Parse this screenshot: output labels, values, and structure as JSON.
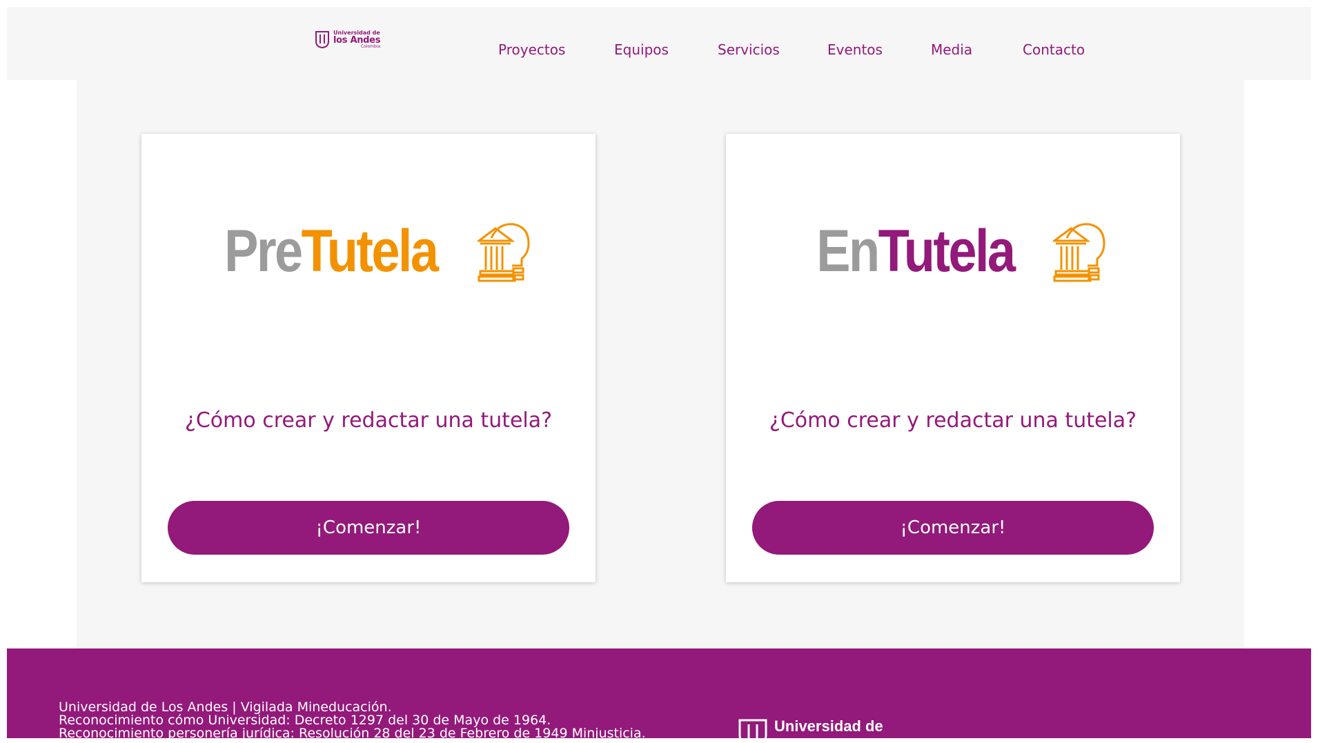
{
  "header": {
    "logo": {
      "line1": "Universidad de",
      "line2": "los Andes",
      "line3": "Colombia"
    },
    "nav": [
      "Proyectos",
      "Equipos",
      "Servicios",
      "Eventos",
      "Media",
      "Contacto"
    ]
  },
  "cards": [
    {
      "brand_prefix": "Pre",
      "brand_main": "Tutela",
      "question": "¿Cómo crear y redactar una tutela?",
      "button": "¡Comenzar!"
    },
    {
      "brand_prefix": "En",
      "brand_main": "Tutela",
      "question": "¿Cómo crear y redactar una tutela?",
      "button": "¡Comenzar!"
    }
  ],
  "footer": {
    "lines": [
      "Universidad de Los Andes | Vigilada Mineducación.",
      "Reconocimiento cómo Universidad: Decreto 1297 del 30 de Mayo de 1964.",
      "Reconocimiento personería jurídica: Resolución 28 del 23 de Febrero de 1949 Minjusticia."
    ],
    "logo_text": "Universidad de"
  },
  "colors": {
    "brand_purple": "#93197a",
    "brand_orange": "#f39200",
    "brand_gray": "#9b9b9b",
    "page_bg": "#f6f6f6"
  }
}
